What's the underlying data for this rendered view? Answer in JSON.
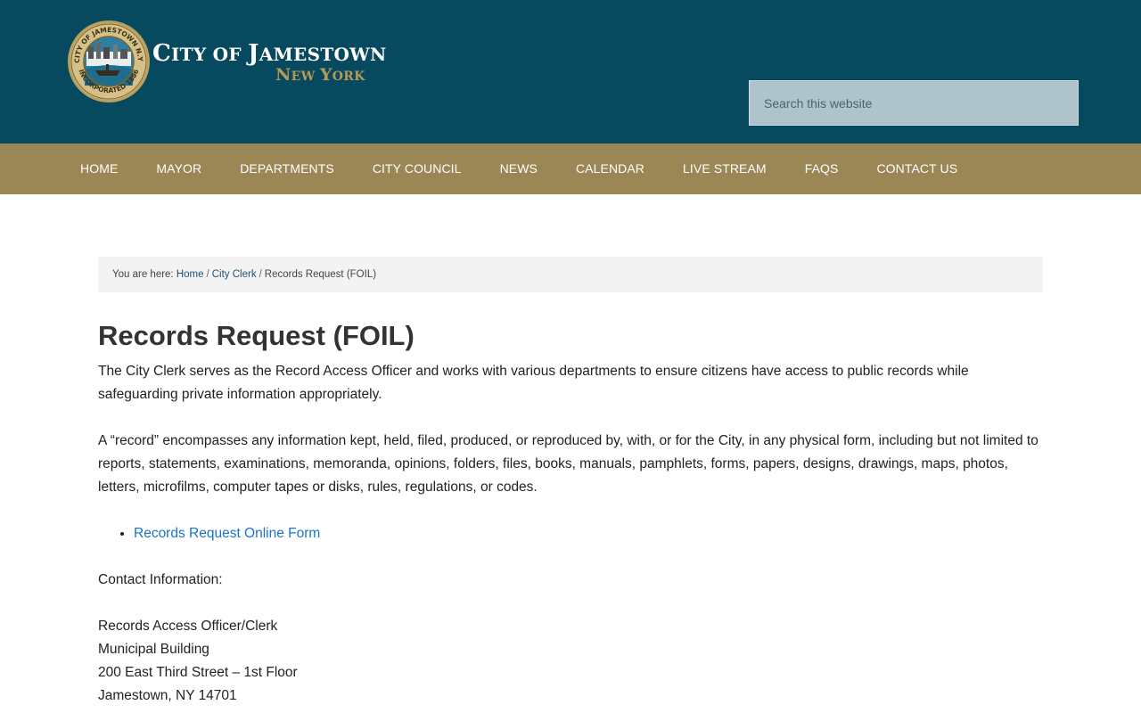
{
  "header": {
    "title_first_letter_1": "C",
    "title_rest_1": "ITY OF ",
    "title_first_letter_2": "J",
    "title_rest_2": "AMESTOWN",
    "subtitle_first_1": "N",
    "subtitle_rest_1": "EW ",
    "subtitle_first_2": "Y",
    "subtitle_rest_2": "ORK",
    "seal_text_top": "CITY OF JAMESTOWN N.Y.",
    "seal_text_bottom": "INCORPORATED 1886",
    "search_placeholder": "Search this website"
  },
  "nav": {
    "items": [
      {
        "label": "HOME"
      },
      {
        "label": "MAYOR"
      },
      {
        "label": "DEPARTMENTS"
      },
      {
        "label": "CITY COUNCIL"
      },
      {
        "label": "NEWS"
      },
      {
        "label": "CALENDAR"
      },
      {
        "label": "LIVE STREAM"
      },
      {
        "label": "FAQS"
      },
      {
        "label": "CONTACT US"
      }
    ]
  },
  "breadcrumb": {
    "prefix": "You are here: ",
    "home": "Home",
    "sep": "/",
    "parent": "City Clerk",
    "current": "Records Request (FOIL)"
  },
  "main": {
    "title": "Records Request (FOIL)",
    "para1": "The City Clerk serves as the Record Access Officer and works with various departments to ensure citizens have access to public records while safeguarding private information appropriately.",
    "para2": "A “record” encompasses any information kept, held, filed, produced, or reproduced by, with, or for the City, in any physical form, including but not limited to reports, statements, examinations, memoranda, opinions, folders, files, books, manuals, pamphlets, forms, papers, designs, drawings, maps, photos, letters, microfilms, computer tapes or disks, rules, regulations, or codes.",
    "link1": "Records Request Online Form",
    "contact_heading": "Contact Information:",
    "contact_lines": [
      "Records Access Officer/Clerk",
      "Municipal Building",
      "200 East Third Street – 1st Floor",
      "Jamestown, NY 14701"
    ]
  },
  "colors": {
    "header_bg": "#07495f",
    "nav_bg": "#9b8756",
    "accent_gold": "#b59a55",
    "link_blue": "#1a73c9"
  }
}
